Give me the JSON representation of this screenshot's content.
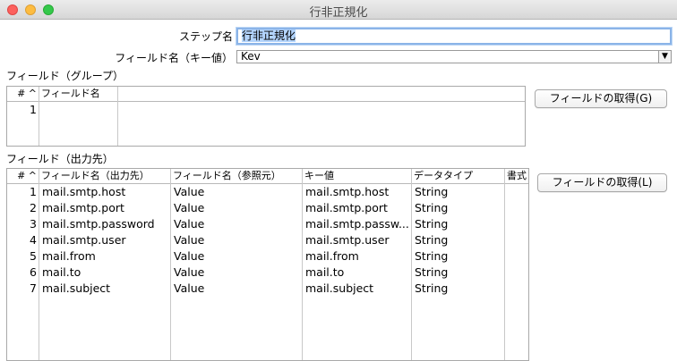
{
  "window": {
    "title": "行非正規化"
  },
  "form": {
    "step_label": "ステップ名",
    "step_value": "行非正規化",
    "key_field_label": "フィールド名（キー値）",
    "key_field_value": "Kev"
  },
  "group_section": {
    "title": "フィールド（グループ）",
    "headers": [
      "# ^",
      "フィールド名"
    ],
    "rows": [
      {
        "num": "1",
        "field": ""
      }
    ],
    "get_button": "フィールドの取得(G)"
  },
  "target_section": {
    "title": "フィールド（出力先）",
    "headers": [
      "# ^",
      "フィールド名（出力先）",
      "フィールド名（参照元）",
      "キー値",
      "データタイプ",
      "書式"
    ],
    "rows": [
      {
        "num": "1",
        "target": "mail.smtp.host",
        "source": "Value",
        "key": "mail.smtp.host",
        "type": "String"
      },
      {
        "num": "2",
        "target": "mail.smtp.port",
        "source": "Value",
        "key": "mail.smtp.port",
        "type": "String"
      },
      {
        "num": "3",
        "target": "mail.smtp.password",
        "source": "Value",
        "key": "mail.smtp.passw...",
        "type": "String"
      },
      {
        "num": "4",
        "target": "mail.smtp.user",
        "source": "Value",
        "key": "mail.smtp.user",
        "type": "String"
      },
      {
        "num": "5",
        "target": "mail.from",
        "source": "Value",
        "key": "mail.from",
        "type": "String"
      },
      {
        "num": "6",
        "target": "mail.to",
        "source": "Value",
        "key": "mail.to",
        "type": "String"
      },
      {
        "num": "7",
        "target": "mail.subject",
        "source": "Value",
        "key": "mail.subject",
        "type": "String"
      }
    ],
    "get_button": "フィールドの取得(L)"
  }
}
